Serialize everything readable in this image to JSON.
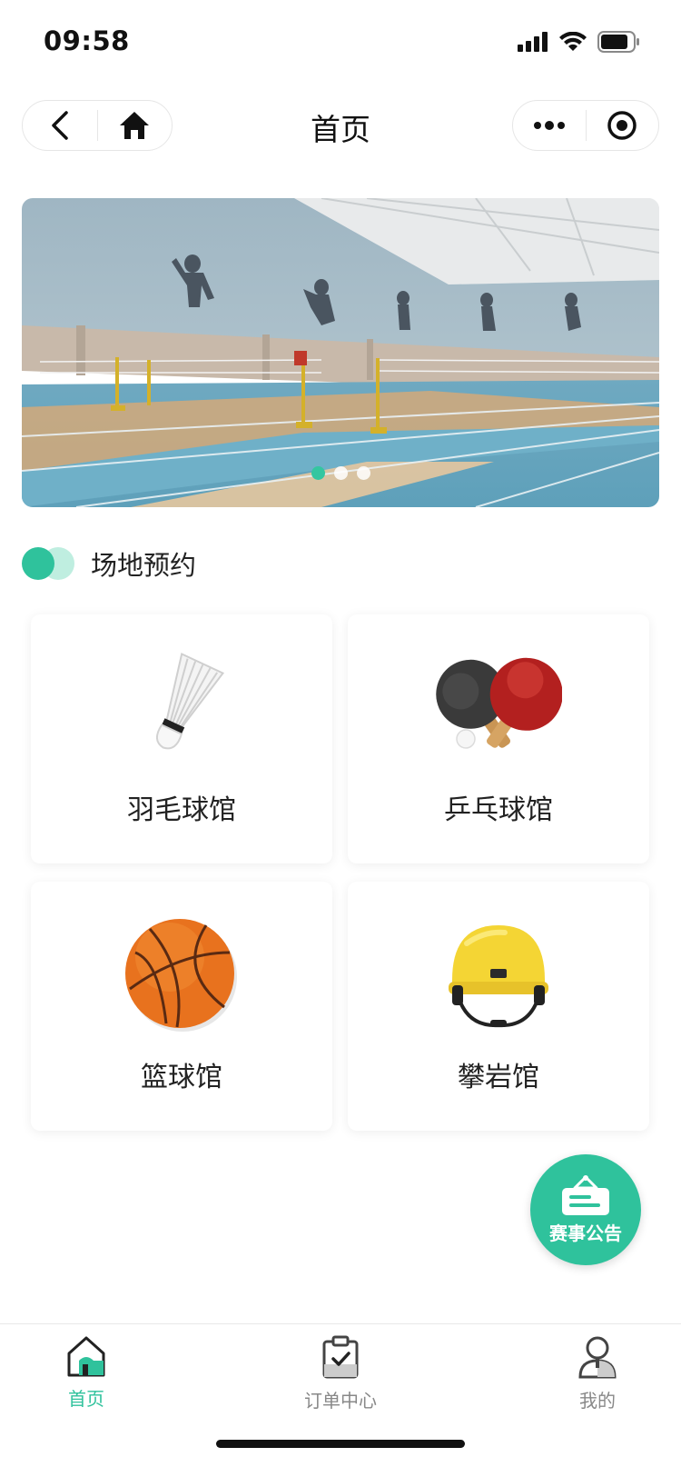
{
  "status_bar": {
    "time": "09:58",
    "icons": [
      "signal-icon",
      "wifi-icon",
      "battery-icon"
    ]
  },
  "nav": {
    "title": "首页",
    "left_icons": [
      "back-icon",
      "home-icon"
    ],
    "right_icons": [
      "more-icon",
      "close-miniprogram-icon"
    ]
  },
  "banner": {
    "dots": 3,
    "active_dot": 1
  },
  "section": {
    "title": "场地预约"
  },
  "venues": [
    {
      "label": "羽毛球馆",
      "icon": "shuttlecock-icon"
    },
    {
      "label": "乒乓球馆",
      "icon": "ping-pong-icon"
    },
    {
      "label": "篮球馆",
      "icon": "basketball-icon"
    },
    {
      "label": "攀岩馆",
      "icon": "climbing-helmet-icon"
    }
  ],
  "fab": {
    "label": "赛事公告",
    "icon": "notice-board-icon"
  },
  "tabs": [
    {
      "label": "首页",
      "icon": "home-tab-icon",
      "active": true
    },
    {
      "label": "订单中心",
      "icon": "clipboard-icon",
      "active": false
    },
    {
      "label": "我的",
      "icon": "user-icon",
      "active": false
    }
  ],
  "colors": {
    "accent": "#2fc29c",
    "accent_light": "#bfeee0",
    "tab_inactive": "#888888"
  }
}
